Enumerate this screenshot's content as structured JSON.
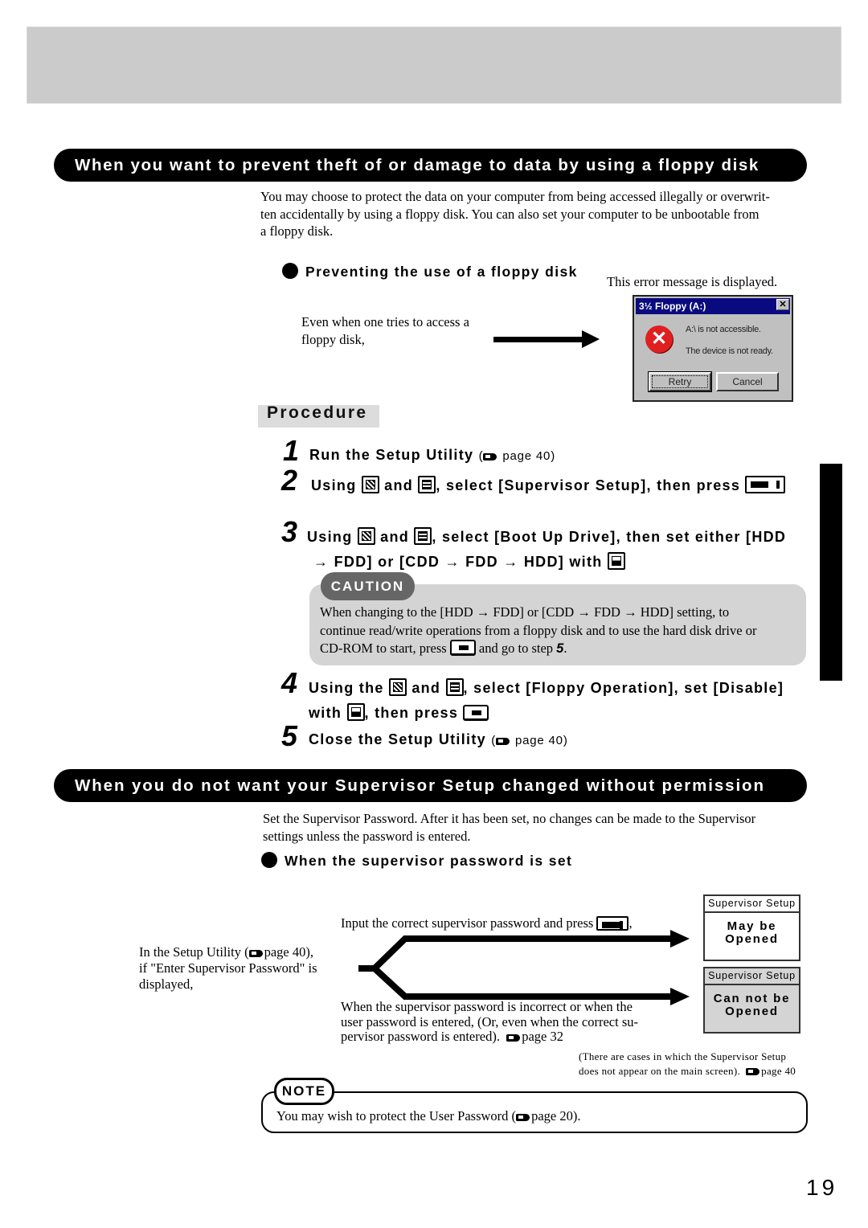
{
  "section1": {
    "banner": "When you want to prevent theft of or damage to data by using a floppy disk",
    "intro": "You may choose to protect the data on your computer from being accessed illegally or overwrit-ten accidentally by using a floppy disk.  You can also set your computer to be unbootable from a floppy disk.",
    "intro_lines": [
      "You may choose to protect the data on your computer from being accessed illegally or overwrit-",
      "ten accidentally by using a floppy disk.  You can also set your computer to be unbootable from",
      "a floppy disk."
    ],
    "bullet_heading": "Preventing the use of a floppy disk",
    "trigger_lines": [
      "Even when one tries to access a",
      "floppy disk,"
    ],
    "result_caption": "This error message is displayed.",
    "dialog": {
      "title": "3½ Floppy (A:)",
      "close_glyph": "✕",
      "error_glyph": "✕",
      "message1": "A:\\ is not accessible.",
      "message2": "The device is not ready.",
      "retry_label": "Retry",
      "cancel_label": "Cancel"
    }
  },
  "procedure": {
    "title": "Procedure",
    "steps": [
      {
        "num": "1",
        "text": "Run the Setup Utility",
        "ref": "page 40"
      },
      {
        "num": "2",
        "parts": [
          "Using",
          "and",
          ", select [Supervisor Setup], then press"
        ]
      },
      {
        "num": "3",
        "parts": [
          "Using",
          "and",
          ", select [Boot Up Drive], then set either [HDD",
          "→ FDD] or [CDD → FDD → HDD] with"
        ]
      },
      {
        "num": "4",
        "parts": [
          "Using the",
          "and",
          ", select [Floppy Operation], set [Disable]",
          "with",
          ", then press"
        ]
      },
      {
        "num": "5",
        "text": "Close the Setup Utility",
        "ref": "page 40"
      }
    ],
    "caution": {
      "label": "CAUTION",
      "line1": "When changing to the [HDD → FDD] or [CDD → FDD → HDD] setting, to",
      "line2": "continue read/write operations from a floppy disk and to use the hard disk drive or",
      "line3_before": "CD-ROM to start, press",
      "line3_after": "and go to step",
      "step_ref": "5",
      "line3_end": "."
    }
  },
  "section2": {
    "banner": "When you do not want your Supervisor Setup changed without permission",
    "intro_lines": [
      "Set the Supervisor Password.  After it has been set, no changes can be made to the Supervisor",
      "settings unless the password is entered."
    ],
    "bullet_heading": "When the supervisor password is set",
    "condition": {
      "line1_before": "In the Setup Utility  (",
      "line1_ref": "page 40),",
      "line2": "if \"Enter Supervisor Password\" is",
      "line3": "displayed,"
    },
    "branch_correct": "Input the correct supervisor password and press",
    "branch_incorrect_lines": [
      "When the supervisor password is incorrect or when the",
      "user password is entered, (Or, even when the correct su-",
      "pervisor password is entered)."
    ],
    "branch_incorrect_ref": "page 32",
    "result_open": {
      "head": "Supervisor Setup",
      "line1": "May be",
      "line2": "Opened"
    },
    "result_closed": {
      "head": "Supervisor Setup",
      "line1": "Can not be",
      "line2": "Opened"
    },
    "footnote_line1": "(There are cases in which the Supervisor Setup",
    "footnote_line2": "does not appear on the main screen).",
    "footnote_ref": "page 40"
  },
  "note": {
    "label": "NOTE",
    "text_before": "You may wish to protect the User Password (",
    "ref": "page 20).",
    "text_after": ""
  },
  "page_number": "19",
  "colors": {
    "banner_bg": "#000000",
    "top_band": "#cbcbcb",
    "caution_box": "#d4d4d4",
    "caution_tab": "#666666",
    "dialog_title": "#0a0a80",
    "dialog_error": "#e02020"
  }
}
